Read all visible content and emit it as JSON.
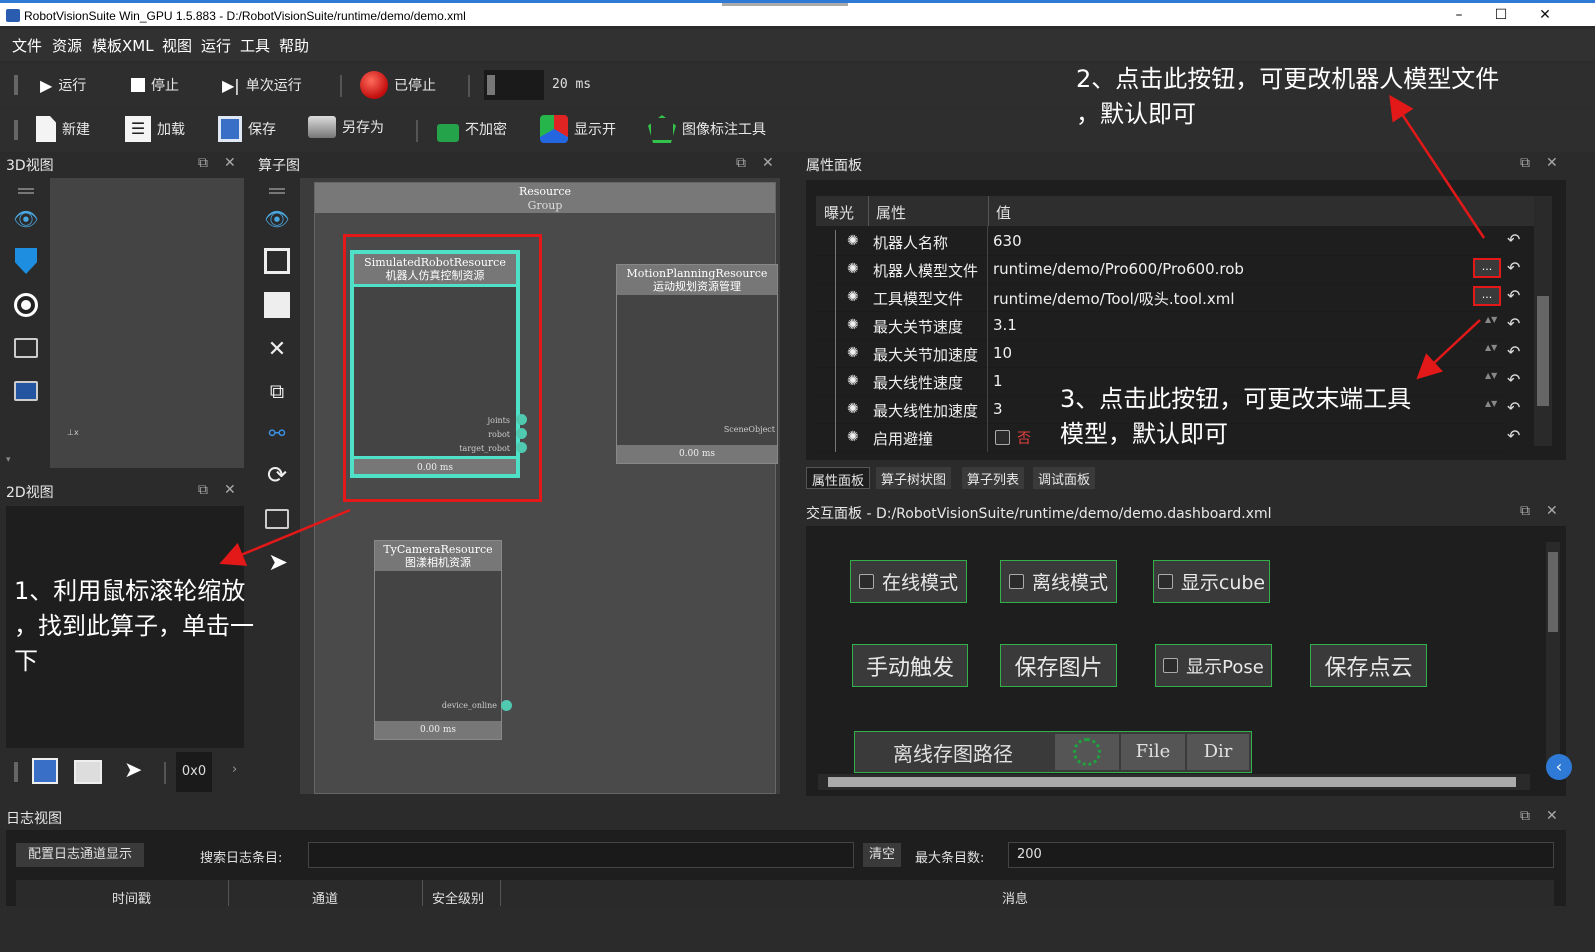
{
  "window": {
    "title": "RobotVisionSuite Win_GPU 1.5.883 - D:/RobotVisionSuite/runtime/demo/demo.xml",
    "min": "–",
    "max": "☐",
    "close": "✕"
  },
  "menu": [
    "文件",
    "资源",
    "模板XML",
    "视图",
    "运行",
    "工具",
    "帮助"
  ],
  "toolbar1": {
    "run": "运行",
    "stop": "停止",
    "step": "单次运行",
    "status": "已停止",
    "interval": "20 ms"
  },
  "toolbar2": {
    "new": "新建",
    "load": "加载",
    "save": "保存",
    "save_as": "另存为",
    "encrypt": "不加密",
    "display": "显示开",
    "annotate": "图像标注工具"
  },
  "panels": {
    "view3d": "3D视图",
    "view2d": "2D视图",
    "graph": "算子图",
    "properties": "属性面板",
    "interaction": "交互面板 - D:/RobotVisionSuite/runtime/demo/demo.dashboard.xml",
    "log": "日志视图"
  },
  "graph": {
    "group_title": "Resource",
    "group_sub": "Group",
    "nodes": [
      {
        "title": "SimulatedRobotResource",
        "sub": "机器人仿真控制资源",
        "ports": [
          "joints",
          "robot",
          "target_robot"
        ],
        "time": "0.00 ms"
      },
      {
        "title": "MotionPlanningResource",
        "sub": "运动规划资源管理",
        "ports": [
          "SceneObject"
        ],
        "time": "0.00 ms"
      },
      {
        "title": "TyCameraResource",
        "sub": "图漾相机资源",
        "ports": [
          "device_online"
        ],
        "time": "0.00 ms"
      }
    ]
  },
  "view2d": {
    "coord": "0x0",
    "arrow": "›"
  },
  "props": {
    "headers": [
      "曝光",
      "属性",
      "值"
    ],
    "rows": [
      {
        "name": "机器人名称",
        "value": "630"
      },
      {
        "name": "机器人模型文件",
        "value": "runtime/demo/Pro600/Pro600.rob"
      },
      {
        "name": "工具模型文件",
        "value": "runtime/demo/Tool/吸头.tool.xml"
      },
      {
        "name": "最大关节速度",
        "value": "3.1"
      },
      {
        "name": "最大关节加速度",
        "value": "10"
      },
      {
        "name": "最大线性速度",
        "value": "1"
      },
      {
        "name": "最大线性加速度",
        "value": "3"
      },
      {
        "name": "启用避撞",
        "value": "否"
      }
    ],
    "ellipsis": "..."
  },
  "tabs": [
    "属性面板",
    "算子树状图",
    "算子列表",
    "调试面板"
  ],
  "dashboard": {
    "online": "在线模式",
    "offline": "离线模式",
    "show_cube": "显示cube",
    "trigger": "手动触发",
    "save_img": "保存图片",
    "show_pose": "显示Pose",
    "save_cloud": "保存点云",
    "path_label": "离线存图路径",
    "file": "File",
    "dir": "Dir"
  },
  "log": {
    "config_btn": "配置日志通道显示",
    "search_label": "搜索日志条目:",
    "search_value": "",
    "clear": "清空",
    "max_label": "最大条目数:",
    "max_value": "200",
    "columns": [
      "时间戳",
      "通道",
      "安全级别",
      "消息"
    ]
  },
  "annotations": {
    "a1": [
      "1、利用鼠标滚轮缩放",
      "，找到此算子，单击一",
      "下"
    ],
    "a2": [
      "2、点击此按钮，可更改机器人模型文件",
      "，默认即可"
    ],
    "a3": [
      "3、点击此按钮，可更改末端工具",
      "模型，默认即可"
    ]
  },
  "colors": {
    "accent_green": "#34b04a",
    "node_cyan": "#4fe0c8",
    "annotation_red": "#e31818"
  }
}
